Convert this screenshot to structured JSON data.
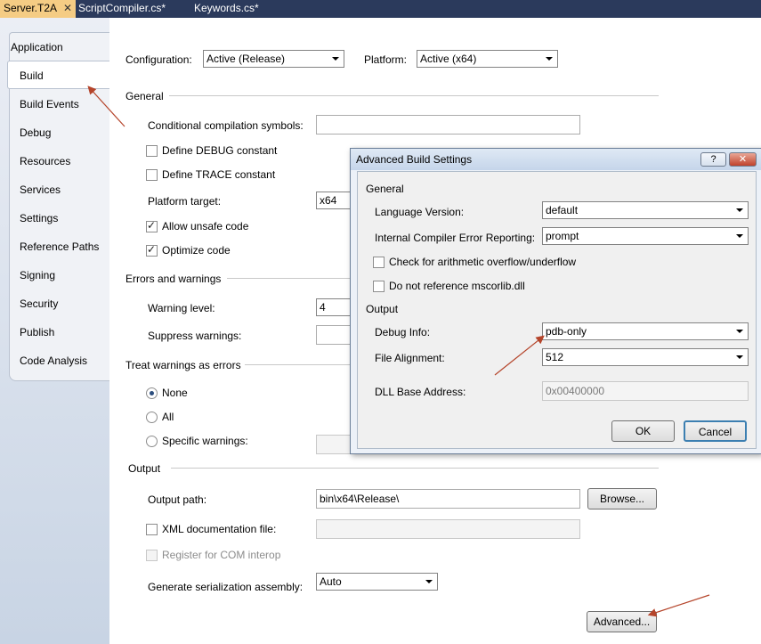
{
  "tabs": [
    {
      "label": "Server.T2A",
      "close": "✕"
    },
    {
      "label": "ScriptCompiler.cs*"
    },
    {
      "label": "Keywords.cs*"
    }
  ],
  "nav": {
    "items": [
      "Application",
      "Build",
      "Build Events",
      "Debug",
      "Resources",
      "Services",
      "Settings",
      "Reference Paths",
      "Signing",
      "Security",
      "Publish",
      "Code Analysis"
    ],
    "selected": "Build"
  },
  "config": {
    "configuration_label": "Configuration:",
    "configuration_value": "Active (Release)",
    "platform_label": "Platform:",
    "platform_value": "Active (x64)"
  },
  "general": {
    "heading": "General",
    "symbols_label": "Conditional compilation symbols:",
    "symbols_value": "",
    "debug_label": "Define DEBUG constant",
    "trace_label": "Define TRACE constant",
    "platform_target_label": "Platform target:",
    "platform_target_value": "x64",
    "unsafe_label": "Allow unsafe code",
    "optimize_label": "Optimize code"
  },
  "errors": {
    "heading": "Errors and warnings",
    "warning_level_label": "Warning level:",
    "warning_level_value": "4",
    "suppress_label": "Suppress warnings:",
    "suppress_value": ""
  },
  "treat": {
    "heading": "Treat warnings as errors",
    "none_label": "None",
    "all_label": "All",
    "specific_label": "Specific warnings:"
  },
  "output": {
    "heading": "Output",
    "path_label": "Output path:",
    "path_value": "bin\\x64\\Release\\",
    "browse_label": "Browse...",
    "xml_label": "XML documentation file:",
    "com_label": "Register for COM interop",
    "serial_label": "Generate serialization assembly:",
    "serial_value": "Auto",
    "advanced_label": "Advanced..."
  },
  "dialog": {
    "title": "Advanced Build Settings",
    "help": "?",
    "close": "✕",
    "general_heading": "General",
    "lang_label": "Language Version:",
    "lang_value": "default",
    "ice_label": "Internal Compiler Error Reporting:",
    "ice_value": "prompt",
    "overflow_label": "Check for arithmetic overflow/underflow",
    "mscorlib_label": "Do not reference mscorlib.dll",
    "output_heading": "Output",
    "debug_info_label": "Debug Info:",
    "debug_info_value": "pdb-only",
    "file_align_label": "File Alignment:",
    "file_align_value": "512",
    "dll_base_label": "DLL Base Address:",
    "dll_base_value": "0x00400000",
    "ok_label": "OK",
    "cancel_label": "Cancel"
  },
  "colors": {
    "tabstrip": "#2b3a5c",
    "active_tab": "#f5cc84",
    "annotation_arrow": "#b5452b"
  }
}
